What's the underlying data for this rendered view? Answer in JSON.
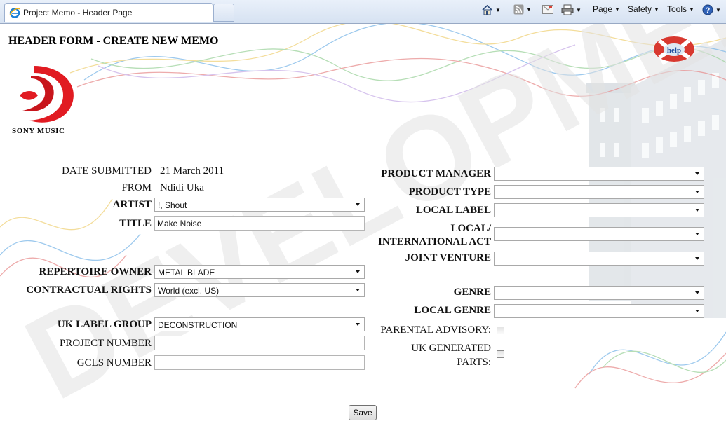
{
  "browser": {
    "tab_title": "Project Memo - Header Page",
    "toolbar": {
      "page": "Page",
      "safety": "Safety",
      "tools": "Tools"
    }
  },
  "page": {
    "heading": "HEADER FORM - CREATE NEW MEMO",
    "logo_text": "SONY MUSIC",
    "watermark": "DEVELOPMENT",
    "help_label": "help"
  },
  "form": {
    "date_submitted": {
      "label": "DATE SUBMITTED",
      "value": "21 March 2011"
    },
    "from": {
      "label": "FROM",
      "value": "Ndidi Uka"
    },
    "artist": {
      "label": "ARTIST",
      "value": "!, Shout"
    },
    "title": {
      "label": "TITLE",
      "value": "Make Noise"
    },
    "repertoire_owner": {
      "label": "REPERTOIRE OWNER",
      "value": "METAL BLADE"
    },
    "contractual_rights": {
      "label": "CONTRACTUAL RIGHTS",
      "value": "World (excl. US)"
    },
    "uk_label_group": {
      "label": "UK LABEL GROUP",
      "value": "DECONSTRUCTION"
    },
    "project_number": {
      "label": "PROJECT NUMBER",
      "value": ""
    },
    "gcls_number": {
      "label": "GCLS NUMBER",
      "value": ""
    },
    "product_manager": {
      "label": "PRODUCT MANAGER",
      "value": ""
    },
    "product_type": {
      "label": "PRODUCT TYPE",
      "value": ""
    },
    "local_label": {
      "label": "LOCAL LABEL",
      "value": ""
    },
    "local_international_act": {
      "label_line1": "LOCAL/",
      "label_line2": "INTERNATIONAL ACT",
      "value": ""
    },
    "joint_venture": {
      "label": "JOINT VENTURE",
      "value": ""
    },
    "genre": {
      "label": "GENRE",
      "value": ""
    },
    "local_genre": {
      "label": "LOCAL GENRE",
      "value": ""
    },
    "parental_advisory": {
      "label": "PARENTAL ADVISORY:",
      "checked": false
    },
    "uk_generated_parts": {
      "label_line1": "UK GENERATED",
      "label_line2": "PARTS:",
      "checked": false
    },
    "save_label": "Save"
  }
}
